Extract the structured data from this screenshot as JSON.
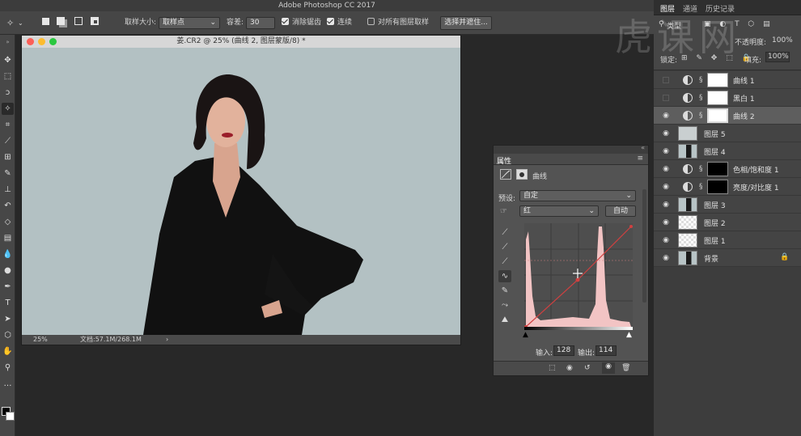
{
  "app": {
    "title": "Adobe Photoshop CC 2017"
  },
  "options_bar": {
    "sample_size_label": "取样大小:",
    "sample_size_value": "取样点",
    "tolerance_label": "容差:",
    "tolerance_value": "30",
    "anti_alias_label": "消除锯齿",
    "anti_alias_checked": true,
    "contiguous_label": "连续",
    "contiguous_checked": true,
    "all_layers_label": "对所有图层取样",
    "all_layers_checked": false,
    "select_mask_button": "选择并遮住..."
  },
  "document": {
    "title": "姜.CR2 @ 25% (曲线 2, 图层蒙版/8) *",
    "zoom": "25%",
    "doc_size": "文档:57.1M/268.1M",
    "status_arrow": "›"
  },
  "properties_panel": {
    "tab_label": "属性",
    "adjustment_name": "曲线",
    "preset_label": "预设:",
    "preset_value": "自定",
    "channel_value": "红",
    "auto_button": "自动",
    "input_label": "输入:",
    "input_value": "128",
    "output_label": "输出:",
    "output_value": "114"
  },
  "right_panel": {
    "tabs": [
      "图层",
      "通道",
      "历史记录"
    ],
    "active_tab": 0,
    "kind_label": "类型",
    "opacity_label": "不透明度:",
    "opacity_value": "100%",
    "lock_label": "锁定:",
    "fill_label": "填充:",
    "fill_value": "100%",
    "layers": [
      {
        "name": "曲线 1",
        "type": "adjustment",
        "visible": false,
        "selected": false
      },
      {
        "name": "黑白 1",
        "type": "adjustment",
        "visible": false,
        "selected": false
      },
      {
        "name": "曲线 2",
        "type": "adjustment",
        "visible": true,
        "selected": true
      },
      {
        "name": "图层 5",
        "type": "pixel",
        "visible": true,
        "selected": false
      },
      {
        "name": "图层 4",
        "type": "pixel",
        "visible": true,
        "selected": false
      },
      {
        "name": "色相/饱和度 1",
        "type": "adjustment-dark",
        "visible": true,
        "selected": false
      },
      {
        "name": "亮度/对比度 1",
        "type": "adjustment-dark",
        "visible": true,
        "selected": false
      },
      {
        "name": "图层 3",
        "type": "pixel",
        "visible": true,
        "selected": false
      },
      {
        "name": "图层 2",
        "type": "transparent",
        "visible": true,
        "selected": false
      },
      {
        "name": "图层 1",
        "type": "transparent",
        "visible": true,
        "selected": false
      },
      {
        "name": "背景",
        "type": "background",
        "visible": true,
        "selected": false,
        "locked": true
      }
    ]
  },
  "watermark": "虎课网",
  "colors": {
    "canvas_bg": "#b5c3c5",
    "histogram": "#f2c4c4",
    "curve_red": "#d04040",
    "panel_bg": "#535353",
    "selected_layer": "#5e5e5e"
  }
}
